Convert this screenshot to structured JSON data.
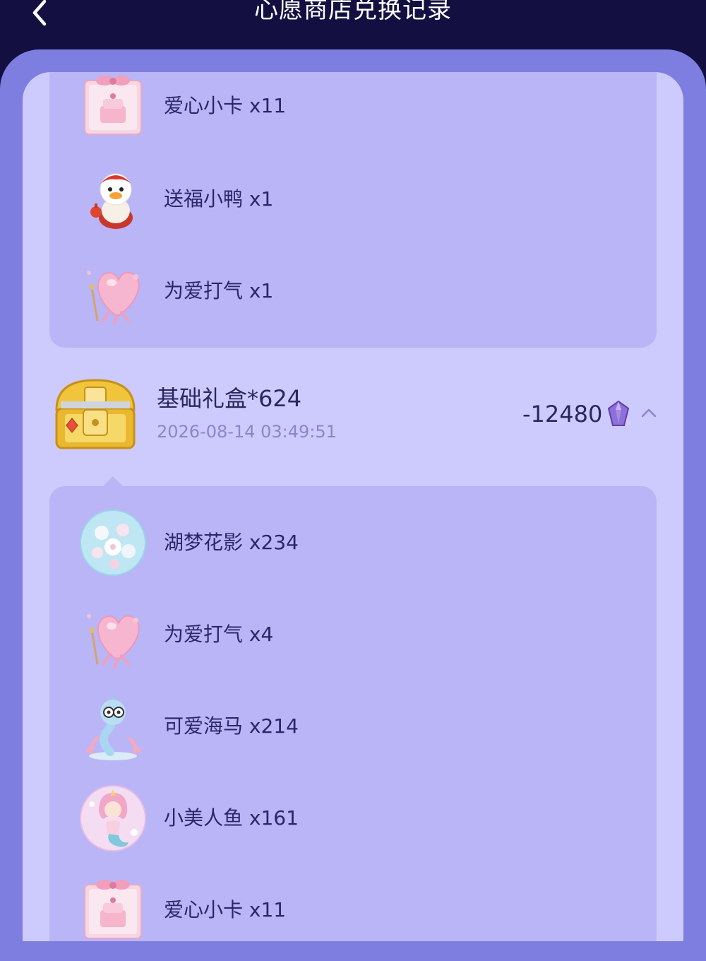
{
  "header": {
    "title": "心愿商店兑换记录",
    "back_icon": "chevron-left-icon"
  },
  "colors": {
    "header_bg": "#131041",
    "outer_panel": "#7e7ee0",
    "inner_panel": "#cdcbfd",
    "sublist_bg": "#b9b5f7",
    "primary_text": "#2a2660",
    "secondary_text": "#8a86c9"
  },
  "top_items": [
    {
      "label": "爱心小卡 x11",
      "icon": "heart-card-icon"
    },
    {
      "label": "送福小鸭 x1",
      "icon": "lucky-duck-icon"
    },
    {
      "label": "为爱打气 x1",
      "icon": "heart-balloon-icon"
    }
  ],
  "record": {
    "title": "基础礼盒*624",
    "time": "2026-08-14 03:49:51",
    "amount": "-12480",
    "amount_icon": "crystal-icon",
    "toggle_icon": "chevron-up-icon",
    "box_icon": "treasure-chest-icon"
  },
  "record_items": [
    {
      "label": "湖梦花影 x234",
      "icon": "flower-orb-icon"
    },
    {
      "label": "为爱打气 x4",
      "icon": "heart-balloon-icon"
    },
    {
      "label": "可爱海马 x214",
      "icon": "seahorse-icon"
    },
    {
      "label": "小美人鱼 x161",
      "icon": "mermaid-icon"
    },
    {
      "label": "爱心小卡 x11",
      "icon": "heart-card-icon"
    }
  ]
}
